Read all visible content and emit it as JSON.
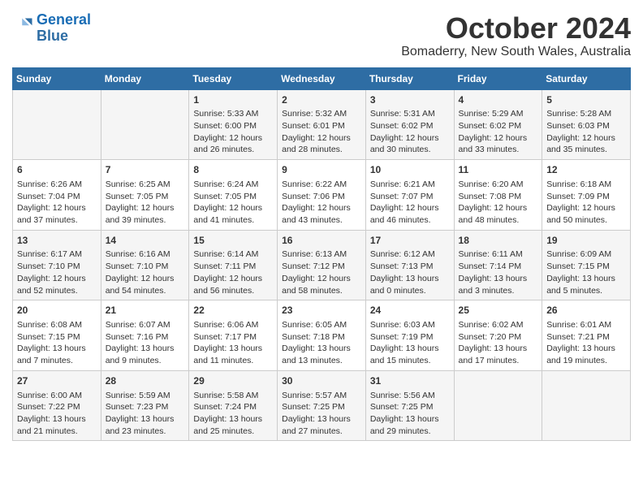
{
  "logo": {
    "line1": "General",
    "line2": "Blue"
  },
  "title": "October 2024",
  "subtitle": "Bomaderry, New South Wales, Australia",
  "weekdays": [
    "Sunday",
    "Monday",
    "Tuesday",
    "Wednesday",
    "Thursday",
    "Friday",
    "Saturday"
  ],
  "weeks": [
    [
      {
        "day": "",
        "info": ""
      },
      {
        "day": "",
        "info": ""
      },
      {
        "day": "1",
        "info": "Sunrise: 5:33 AM\nSunset: 6:00 PM\nDaylight: 12 hours\nand 26 minutes."
      },
      {
        "day": "2",
        "info": "Sunrise: 5:32 AM\nSunset: 6:01 PM\nDaylight: 12 hours\nand 28 minutes."
      },
      {
        "day": "3",
        "info": "Sunrise: 5:31 AM\nSunset: 6:02 PM\nDaylight: 12 hours\nand 30 minutes."
      },
      {
        "day": "4",
        "info": "Sunrise: 5:29 AM\nSunset: 6:02 PM\nDaylight: 12 hours\nand 33 minutes."
      },
      {
        "day": "5",
        "info": "Sunrise: 5:28 AM\nSunset: 6:03 PM\nDaylight: 12 hours\nand 35 minutes."
      }
    ],
    [
      {
        "day": "6",
        "info": "Sunrise: 6:26 AM\nSunset: 7:04 PM\nDaylight: 12 hours\nand 37 minutes."
      },
      {
        "day": "7",
        "info": "Sunrise: 6:25 AM\nSunset: 7:05 PM\nDaylight: 12 hours\nand 39 minutes."
      },
      {
        "day": "8",
        "info": "Sunrise: 6:24 AM\nSunset: 7:05 PM\nDaylight: 12 hours\nand 41 minutes."
      },
      {
        "day": "9",
        "info": "Sunrise: 6:22 AM\nSunset: 7:06 PM\nDaylight: 12 hours\nand 43 minutes."
      },
      {
        "day": "10",
        "info": "Sunrise: 6:21 AM\nSunset: 7:07 PM\nDaylight: 12 hours\nand 46 minutes."
      },
      {
        "day": "11",
        "info": "Sunrise: 6:20 AM\nSunset: 7:08 PM\nDaylight: 12 hours\nand 48 minutes."
      },
      {
        "day": "12",
        "info": "Sunrise: 6:18 AM\nSunset: 7:09 PM\nDaylight: 12 hours\nand 50 minutes."
      }
    ],
    [
      {
        "day": "13",
        "info": "Sunrise: 6:17 AM\nSunset: 7:10 PM\nDaylight: 12 hours\nand 52 minutes."
      },
      {
        "day": "14",
        "info": "Sunrise: 6:16 AM\nSunset: 7:10 PM\nDaylight: 12 hours\nand 54 minutes."
      },
      {
        "day": "15",
        "info": "Sunrise: 6:14 AM\nSunset: 7:11 PM\nDaylight: 12 hours\nand 56 minutes."
      },
      {
        "day": "16",
        "info": "Sunrise: 6:13 AM\nSunset: 7:12 PM\nDaylight: 12 hours\nand 58 minutes."
      },
      {
        "day": "17",
        "info": "Sunrise: 6:12 AM\nSunset: 7:13 PM\nDaylight: 13 hours\nand 0 minutes."
      },
      {
        "day": "18",
        "info": "Sunrise: 6:11 AM\nSunset: 7:14 PM\nDaylight: 13 hours\nand 3 minutes."
      },
      {
        "day": "19",
        "info": "Sunrise: 6:09 AM\nSunset: 7:15 PM\nDaylight: 13 hours\nand 5 minutes."
      }
    ],
    [
      {
        "day": "20",
        "info": "Sunrise: 6:08 AM\nSunset: 7:15 PM\nDaylight: 13 hours\nand 7 minutes."
      },
      {
        "day": "21",
        "info": "Sunrise: 6:07 AM\nSunset: 7:16 PM\nDaylight: 13 hours\nand 9 minutes."
      },
      {
        "day": "22",
        "info": "Sunrise: 6:06 AM\nSunset: 7:17 PM\nDaylight: 13 hours\nand 11 minutes."
      },
      {
        "day": "23",
        "info": "Sunrise: 6:05 AM\nSunset: 7:18 PM\nDaylight: 13 hours\nand 13 minutes."
      },
      {
        "day": "24",
        "info": "Sunrise: 6:03 AM\nSunset: 7:19 PM\nDaylight: 13 hours\nand 15 minutes."
      },
      {
        "day": "25",
        "info": "Sunrise: 6:02 AM\nSunset: 7:20 PM\nDaylight: 13 hours\nand 17 minutes."
      },
      {
        "day": "26",
        "info": "Sunrise: 6:01 AM\nSunset: 7:21 PM\nDaylight: 13 hours\nand 19 minutes."
      }
    ],
    [
      {
        "day": "27",
        "info": "Sunrise: 6:00 AM\nSunset: 7:22 PM\nDaylight: 13 hours\nand 21 minutes."
      },
      {
        "day": "28",
        "info": "Sunrise: 5:59 AM\nSunset: 7:23 PM\nDaylight: 13 hours\nand 23 minutes."
      },
      {
        "day": "29",
        "info": "Sunrise: 5:58 AM\nSunset: 7:24 PM\nDaylight: 13 hours\nand 25 minutes."
      },
      {
        "day": "30",
        "info": "Sunrise: 5:57 AM\nSunset: 7:25 PM\nDaylight: 13 hours\nand 27 minutes."
      },
      {
        "day": "31",
        "info": "Sunrise: 5:56 AM\nSunset: 7:25 PM\nDaylight: 13 hours\nand 29 minutes."
      },
      {
        "day": "",
        "info": ""
      },
      {
        "day": "",
        "info": ""
      }
    ]
  ]
}
